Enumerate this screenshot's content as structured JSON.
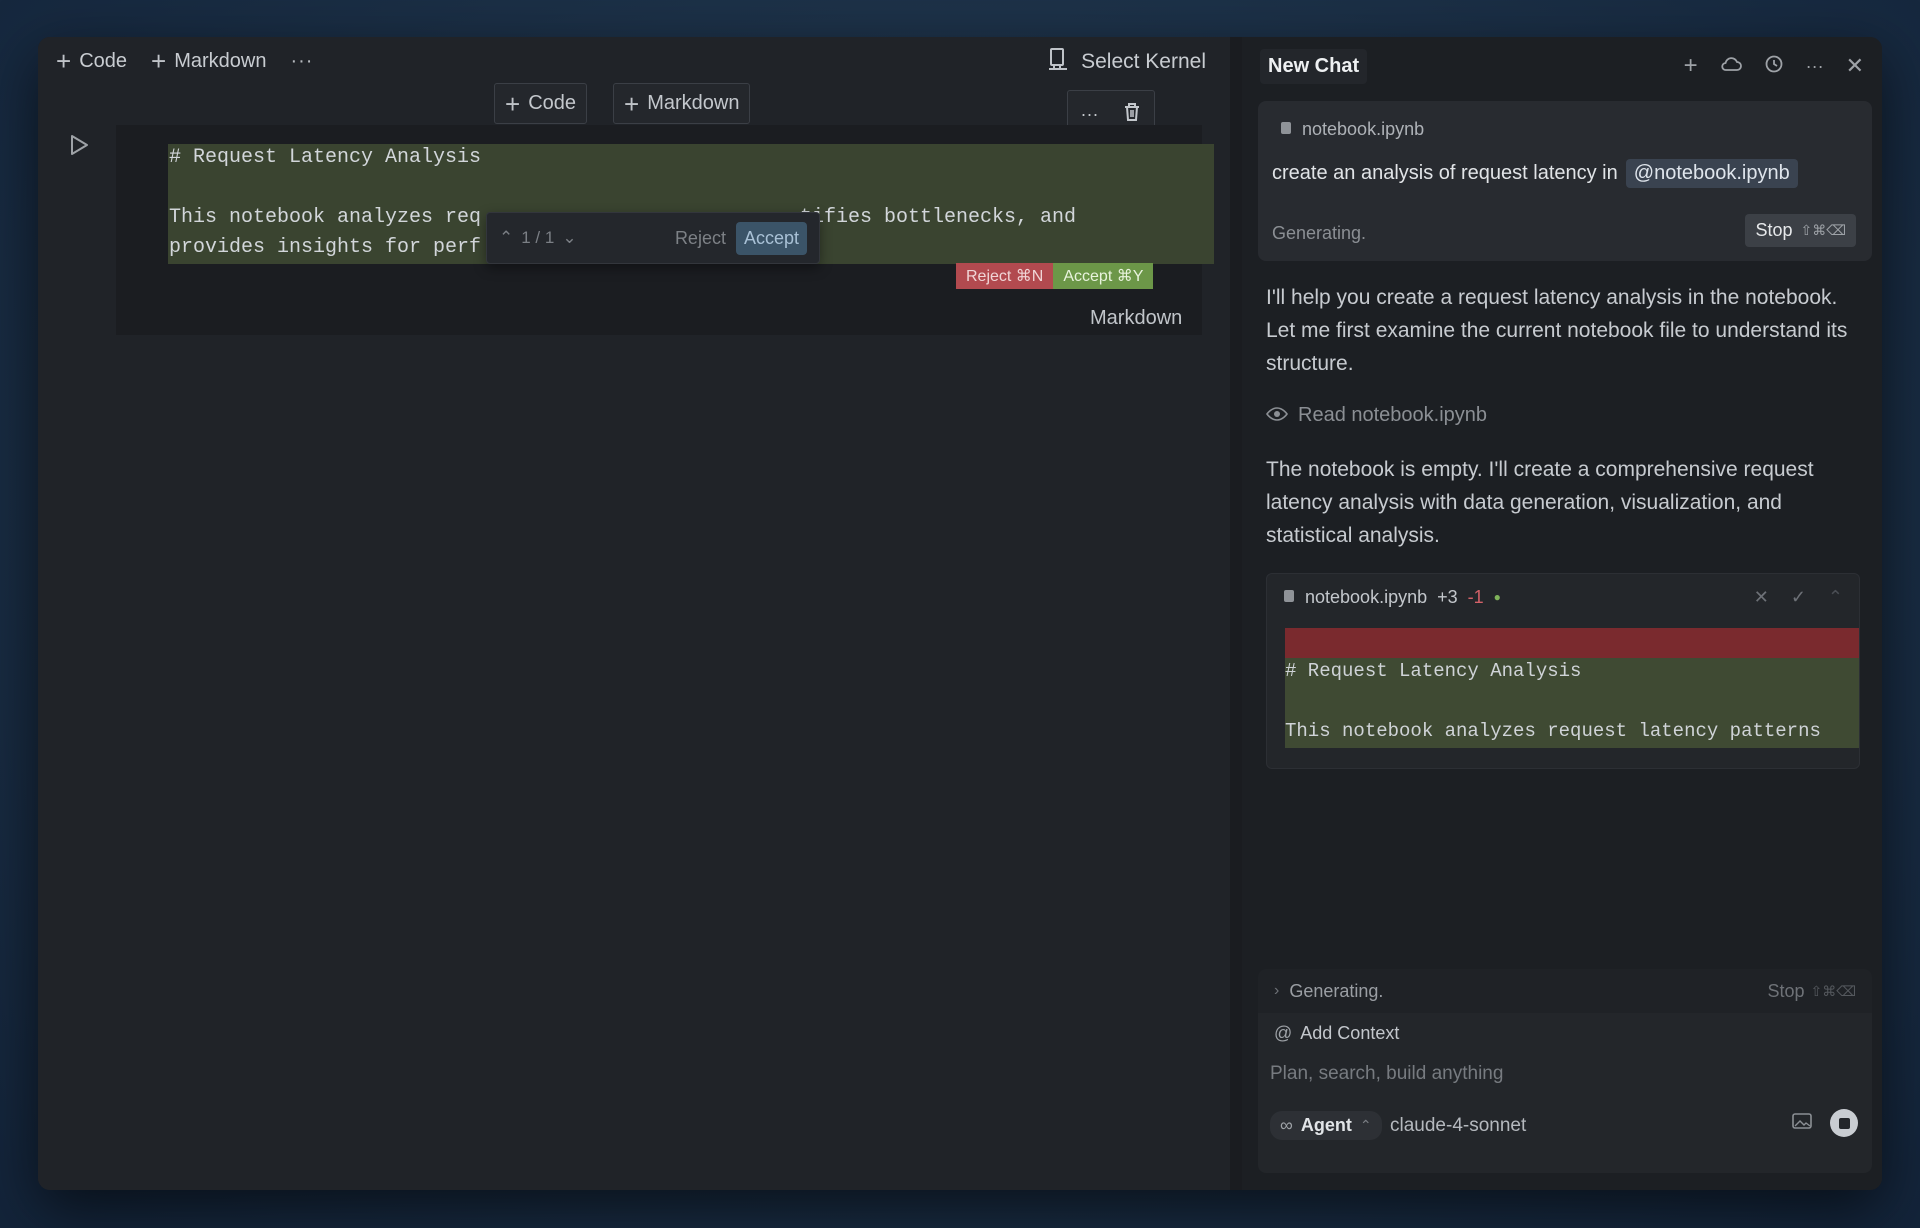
{
  "notebook": {
    "toolbar": {
      "code_label": "Code",
      "markdown_label": "Markdown",
      "more_label": "···",
      "kernel_label": "Select Kernel"
    },
    "insert": {
      "code_label": "Code",
      "markdown_label": "Markdown"
    },
    "cell": {
      "line1": "# Request Latency Analysis",
      "line3a": "This notebook analyzes req",
      "line3b": "tifies bottlenecks, and",
      "line4": "provides insights for perf",
      "type_label": "Markdown"
    },
    "inline_review": {
      "counter": "1 / 1",
      "reject_label": "Reject",
      "accept_label": "Accept"
    },
    "cell_review": {
      "reject_label": "Reject ⌘N",
      "accept_label": "Accept ⌘Y"
    }
  },
  "chat": {
    "title": "New Chat",
    "query": {
      "file_name": "notebook.ipynb",
      "text": "create an analysis of request latency in",
      "mention": "@notebook.ipynb",
      "status": "Generating.",
      "stop_label": "Stop",
      "stop_shortcut": "⇧⌘⌫"
    },
    "messages": [
      "I'll help you create a request latency analysis in the notebook. Let me first examine the current notebook file to understand its structure.",
      "The notebook is empty. I'll create a comprehensive request latency analysis with data generation, visualization, and statistical analysis."
    ],
    "read_step": "Read notebook.ipynb",
    "diff": {
      "file_name": "notebook.ipynb",
      "added": "+3",
      "removed": "-1",
      "line1": "# Request Latency Analysis",
      "line2": "This notebook analyzes request latency patterns"
    },
    "generating_bar": {
      "label": "Generating.",
      "stop_label": "Stop",
      "stop_shortcut": "⇧⌘⌫"
    },
    "composer": {
      "add_context": "Add Context",
      "placeholder": "Plan, search, build anything",
      "mode": "Agent",
      "model": "claude-4-sonnet"
    }
  }
}
